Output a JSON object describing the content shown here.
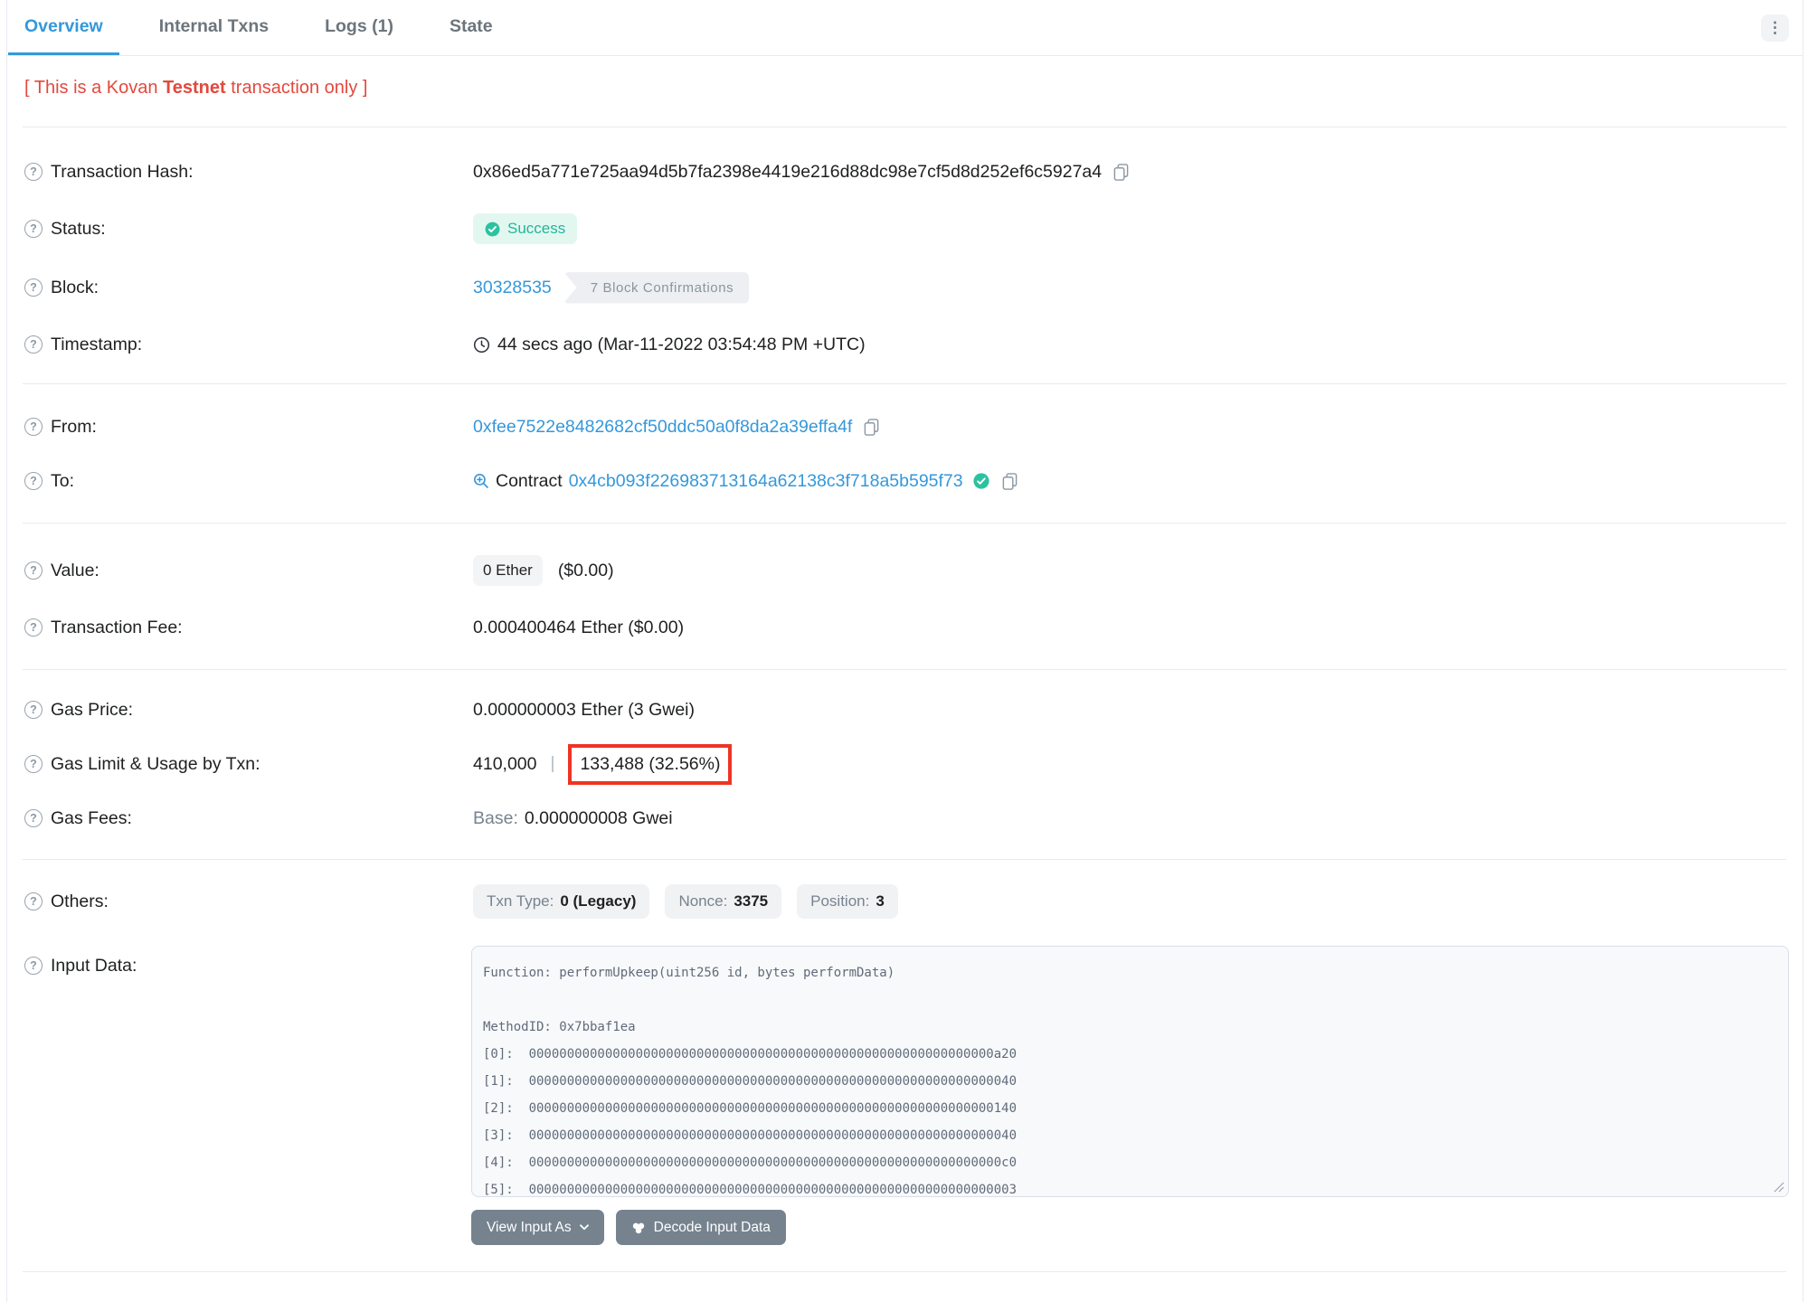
{
  "tabs": {
    "items": [
      {
        "label": "Overview"
      },
      {
        "label": "Internal Txns"
      },
      {
        "label": "Logs (1)"
      },
      {
        "label": "State"
      }
    ],
    "kebab_glyph": "⋮"
  },
  "icons": {
    "help": "?"
  },
  "notice": {
    "prefix": "[ This is a Kovan ",
    "bold": "Testnet",
    "suffix": " transaction only ]"
  },
  "rows": {
    "transaction_hash": {
      "label": "Transaction Hash:",
      "value": "0x86ed5a771e725aa94d5b7fa2398e4419e216d88dc98e7cf5d8d252ef6c5927a4"
    },
    "status": {
      "label": "Status:",
      "badge": "Success"
    },
    "block": {
      "label": "Block:",
      "number": "30328535",
      "confirmations": "7 Block Confirmations"
    },
    "timestamp": {
      "label": "Timestamp:",
      "value": "44 secs ago (Mar-11-2022 03:54:48 PM +UTC)"
    },
    "from": {
      "label": "From:",
      "address": "0xfee7522e8482682cf50ddc50a0f8da2a39effa4f"
    },
    "to": {
      "label": "To:",
      "contract_prefix": "Contract",
      "address": "0x4cb093f226983713164a62138c3f718a5b595f73"
    },
    "value": {
      "label": "Value:",
      "amount": "0 Ether",
      "usd": "($0.00)"
    },
    "transaction_fee": {
      "label": "Transaction Fee:",
      "value": "0.000400464 Ether ($0.00)"
    },
    "gas_price": {
      "label": "Gas Price:",
      "value": "0.000000003 Ether (3 Gwei)"
    },
    "gas_limit_usage": {
      "label": "Gas Limit & Usage by Txn:",
      "limit": "410,000",
      "separator": "|",
      "usage": "133,488 (32.56%)"
    },
    "gas_fees": {
      "label": "Gas Fees:",
      "base_label": "Base:",
      "base_value": "0.000000008 Gwei"
    },
    "others": {
      "label": "Others:",
      "badges": [
        {
          "name": "Txn Type:",
          "value": "0 (Legacy)"
        },
        {
          "name": "Nonce:",
          "value": "3375"
        },
        {
          "name": "Position:",
          "value": "3"
        }
      ]
    },
    "input_data": {
      "label": "Input Data:",
      "function_line": "Function: performUpkeep(uint256 id, bytes performData)",
      "method_id": "MethodID: 0x7bbaf1ea",
      "words": [
        {
          "index": "[0]:",
          "value": "0000000000000000000000000000000000000000000000000000000000000a20"
        },
        {
          "index": "[1]:",
          "value": "0000000000000000000000000000000000000000000000000000000000000040"
        },
        {
          "index": "[2]:",
          "value": "0000000000000000000000000000000000000000000000000000000000000140"
        },
        {
          "index": "[3]:",
          "value": "0000000000000000000000000000000000000000000000000000000000000040"
        },
        {
          "index": "[4]:",
          "value": "00000000000000000000000000000000000000000000000000000000000000c0"
        },
        {
          "index": "[5]:",
          "value": "0000000000000000000000000000000000000000000000000000000000000003"
        }
      ]
    }
  },
  "buttons": {
    "view_input_as": "View Input As",
    "decode_input_data": "Decode Input Data"
  },
  "colors": {
    "link": "#3498db",
    "text": "#1e2022",
    "muted": "#77838f",
    "divider": "#e7eaf3",
    "success": "#23b59c",
    "success_bg": "#e3f7f1",
    "notice_red": "#e2493e",
    "highlight_red": "#ee3424",
    "button_bg": "#76838f"
  }
}
